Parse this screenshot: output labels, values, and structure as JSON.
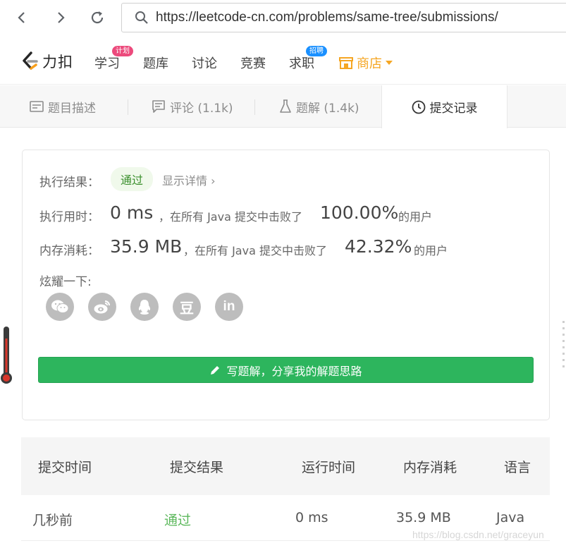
{
  "browser": {
    "url": "https://leetcode-cn.com/problems/same-tree/submissions/"
  },
  "header": {
    "logo_text": "力扣",
    "nav": [
      {
        "label": "学习",
        "badge": "计划"
      },
      {
        "label": "题库"
      },
      {
        "label": "讨论"
      },
      {
        "label": "竞赛"
      },
      {
        "label": "求职",
        "badge": "招聘"
      }
    ],
    "shop_label": "商店",
    "accent_color": "#f5a623"
  },
  "tabs": [
    {
      "label": "题目描述"
    },
    {
      "label": "评论 (1.1k)"
    },
    {
      "label": "题解 (1.4k)"
    },
    {
      "label": "提交记录"
    }
  ],
  "result": {
    "status_label": "执行结果：",
    "status_value": "通过",
    "detail_link": "显示详情 ›",
    "time_label": "执行用时：",
    "time_value": "0 ms",
    "time_mid": "，在所有 Java 提交中击败了",
    "time_percent": "100.00%",
    "time_suffix": "的用户",
    "memory_label": "内存消耗：",
    "memory_value": "35.9 MB",
    "memory_mid": "，在所有 Java 提交中击败了",
    "memory_percent": "42.32%",
    "memory_suffix": "的用户",
    "share_label": "炫耀一下:",
    "share_icons": [
      "wechat-icon",
      "weibo-icon",
      "qq-icon",
      "douban-icon",
      "linkedin-icon"
    ],
    "douban_glyph": "豆",
    "linkedin_glyph": "in",
    "write_button": "写题解，分享我的解题思路"
  },
  "table": {
    "headers": [
      "提交时间",
      "提交结果",
      "运行时间",
      "内存消耗",
      "语言"
    ],
    "rows": [
      {
        "time": "几秒前",
        "result": "通过",
        "runtime": "0 ms",
        "memory": "35.9 MB",
        "language": "Java"
      }
    ]
  },
  "watermark": "https://blog.csdn.net/graceyun"
}
